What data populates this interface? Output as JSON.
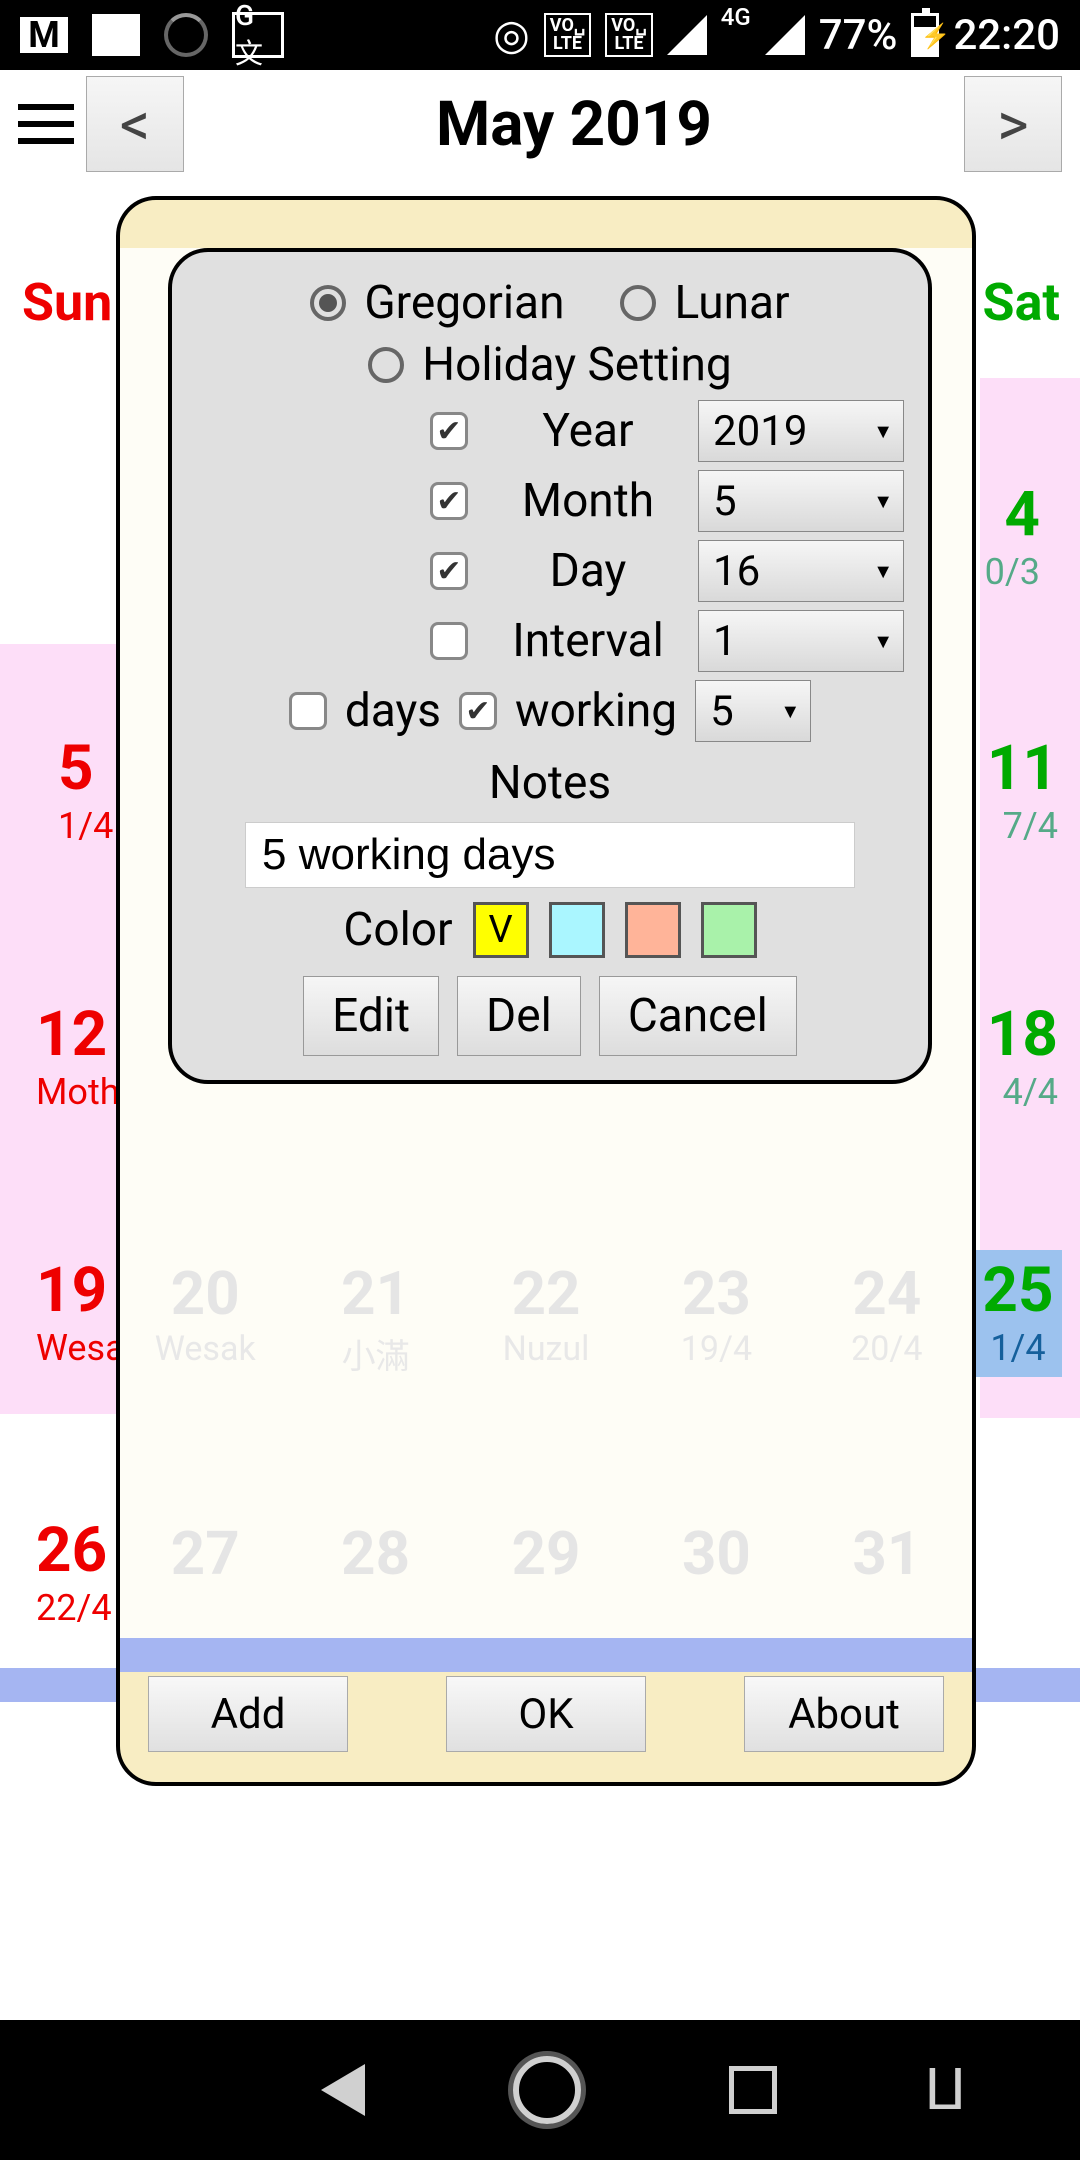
{
  "status": {
    "battery": "77%",
    "time": "22:20",
    "net": "4G"
  },
  "header": {
    "title": "May 2019"
  },
  "inner": {
    "radio_gregorian": "Gregorian",
    "radio_lunar": "Lunar",
    "radio_holiday": "Holiday Setting",
    "year_label": "Year",
    "year_value": "2019",
    "month_label": "Month",
    "month_value": "5",
    "day_label": "Day",
    "day_value": "16",
    "interval_label": "Interval",
    "interval_value": "1",
    "days_label": "days",
    "working_label": "working",
    "working_value": "5",
    "notes_label": "Notes",
    "notes_value": "5 working days",
    "color_label": "Color",
    "color_mark": "V",
    "edit": "Edit",
    "del": "Del",
    "cancel": "Cancel"
  },
  "outer": {
    "add": "Add",
    "ok": "OK",
    "about": "About"
  },
  "calendar": {
    "sun": "Sun",
    "sat": "Sat",
    "cells": {
      "d4": "4",
      "d4s": "0/3",
      "d5": "5",
      "d5s": "1/4",
      "d11": "11",
      "d11s": "7/4",
      "d12": "12",
      "d12s": "Moth",
      "d18": "18",
      "d18s": "4/4",
      "d19": "19",
      "d19s": "Wesa",
      "d25": "25",
      "d25s": "1/4",
      "d26": "26",
      "d26s": "22/4"
    },
    "faint": {
      "r3": [
        "20",
        "21",
        "22",
        "23",
        "24"
      ],
      "r3s": [
        "Wesak",
        "小滿",
        "Nuzul",
        "19/4",
        "20/4"
      ],
      "r4": [
        "27",
        "28",
        "29",
        "30",
        "31"
      ]
    }
  }
}
